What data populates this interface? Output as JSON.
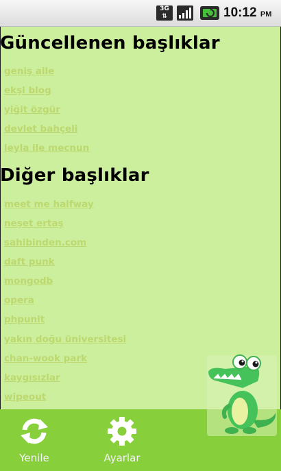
{
  "status_bar": {
    "network": "3G",
    "time": "10:12",
    "ampm": "PM"
  },
  "sections": {
    "updated": {
      "title": "Güncellenen başlıklar",
      "items": [
        "geniş aile",
        "ekşi blog",
        "yiğit özgür",
        "devlet bahçeli",
        "leyla ile mecnun"
      ]
    },
    "other": {
      "title": "Diğer başlıklar",
      "items": [
        "meet me halfway",
        "neşet ertaş",
        "sahibinden.com",
        "daft punk",
        "mongodb",
        "opera",
        "phpunit",
        "yakın doğu üniversitesi",
        "chan-wook park",
        "kaygısızlar",
        "wipeout"
      ]
    }
  },
  "bottom_bar": {
    "refresh_label": "Yenile",
    "settings_label": "Ayarlar"
  },
  "colors": {
    "background": "#ccef9e",
    "link": "#bcd86e",
    "bottom_bar": "#88cf3c",
    "mascot": "#46c25a"
  },
  "icons": [
    "refresh-icon",
    "gear-icon",
    "signal-icon",
    "battery-icon",
    "crocodile-mascot"
  ]
}
